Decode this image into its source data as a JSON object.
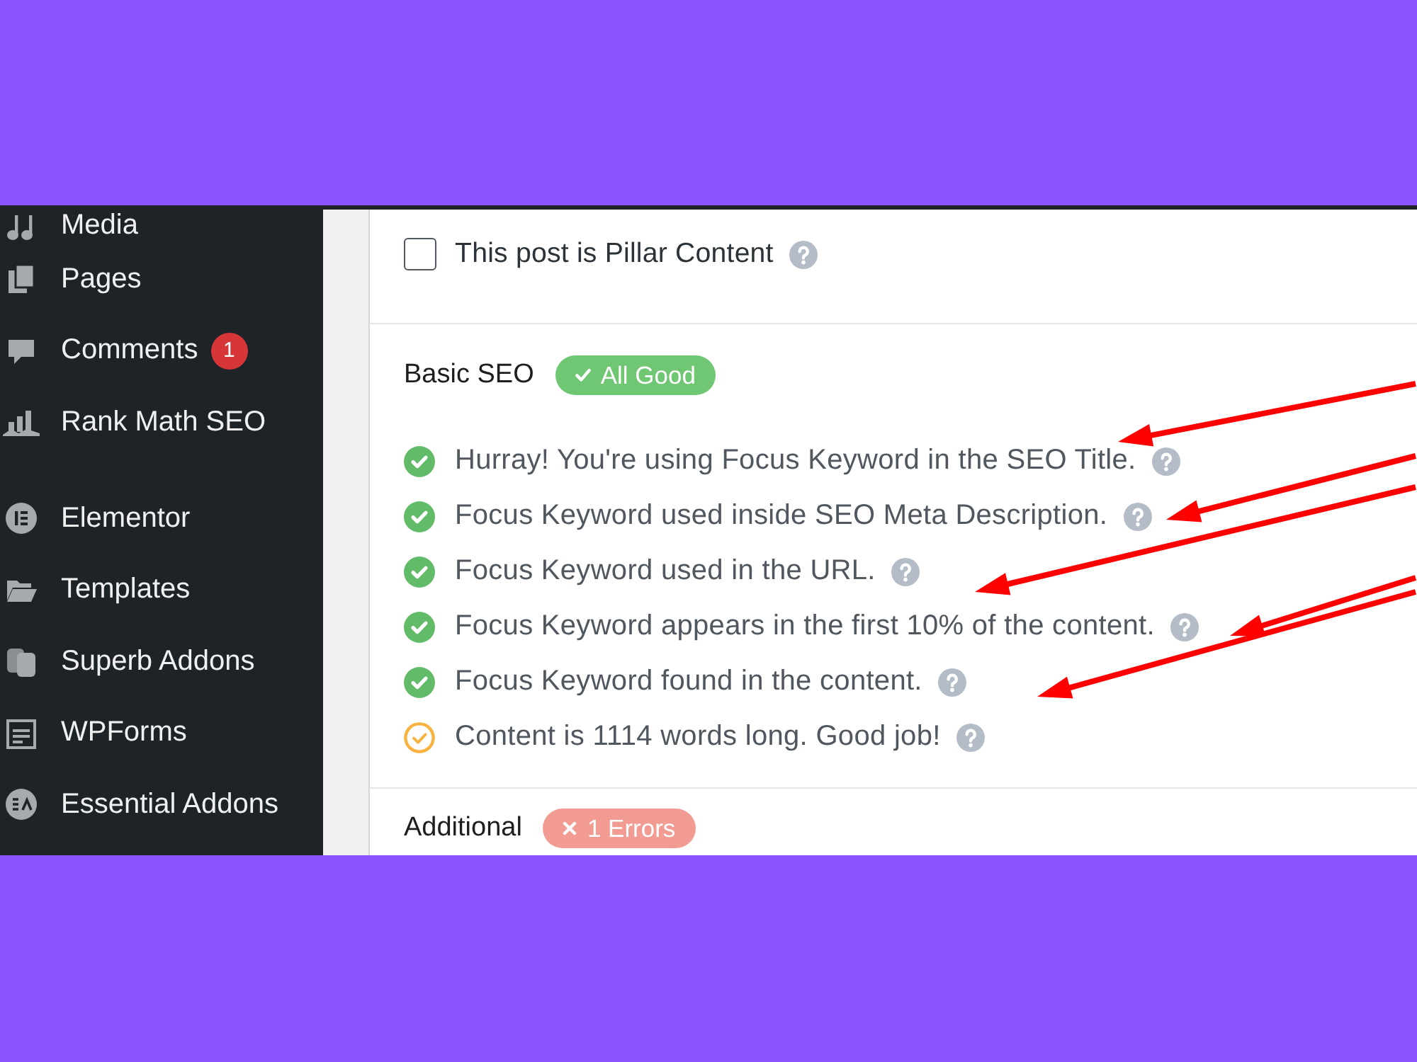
{
  "sidebar": {
    "groups": [
      {
        "items": [
          {
            "label": "Media"
          },
          {
            "label": "Pages"
          },
          {
            "label": "Comments",
            "badge": "1"
          },
          {
            "label": "Rank Math SEO"
          }
        ]
      },
      {
        "items": [
          {
            "label": "Elementor"
          },
          {
            "label": "Templates"
          },
          {
            "label": "Superb Addons"
          },
          {
            "label": "WPForms"
          },
          {
            "label": "Essential Addons"
          }
        ]
      }
    ]
  },
  "pillar": {
    "label": "This post is Pillar Content",
    "checked": false
  },
  "sections": [
    {
      "title": "Basic SEO",
      "badge": {
        "kind": "good",
        "label": "All Good"
      },
      "checks": [
        {
          "kind": "pass",
          "text": "Hurray! You're using Focus Keyword in the SEO Title."
        },
        {
          "kind": "pass",
          "text": "Focus Keyword used inside SEO Meta Description."
        },
        {
          "kind": "pass",
          "text": "Focus Keyword used in the URL."
        },
        {
          "kind": "pass",
          "text": "Focus Keyword appears in the first 10% of the content."
        },
        {
          "kind": "pass",
          "text": "Focus Keyword found in the content."
        },
        {
          "kind": "warning",
          "text": "Content is 1114 words long. Good job!"
        }
      ]
    },
    {
      "title": "Additional",
      "badge": {
        "kind": "error",
        "label": "1 Errors"
      }
    }
  ]
}
